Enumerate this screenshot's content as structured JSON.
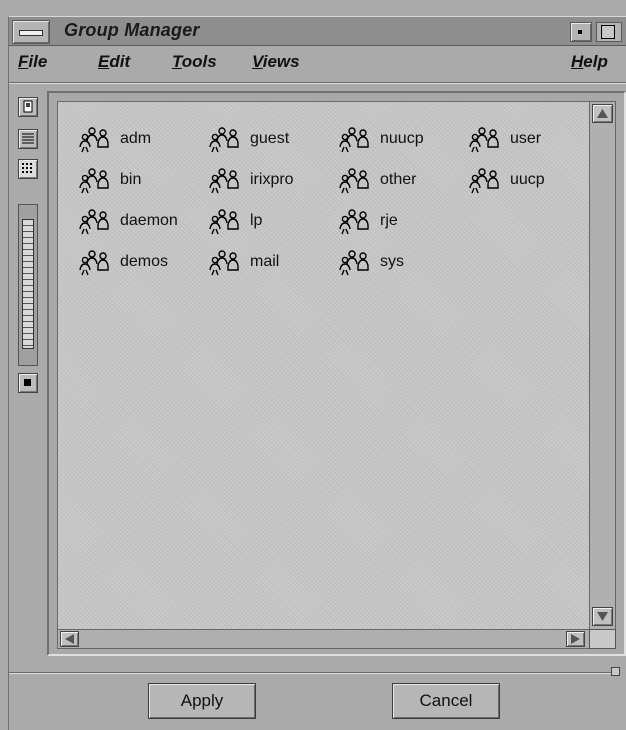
{
  "window": {
    "title": "Group Manager"
  },
  "menubar": {
    "items": [
      {
        "label": "File",
        "mnemonic": "F",
        "rest": "ile"
      },
      {
        "label": "Edit",
        "mnemonic": "E",
        "rest": "dit"
      },
      {
        "label": "Tools",
        "mnemonic": "T",
        "rest": "ools"
      },
      {
        "label": "Views",
        "mnemonic": "V",
        "rest": "iews"
      },
      {
        "label": "Help",
        "mnemonic": "H",
        "rest": "elp"
      }
    ]
  },
  "toolbar": {
    "icons": [
      "view-shelf-icon",
      "list-view-icon",
      "grid-view-icon",
      "zoom-slider",
      "zoom-reset-icon"
    ]
  },
  "groups": {
    "icon": "group-people-icon",
    "items": [
      "adm",
      "guest",
      "nuucp",
      "user",
      "bin",
      "irixpro",
      "other",
      "uucp",
      "daemon",
      "lp",
      "rje",
      "demos",
      "mail",
      "sys"
    ]
  },
  "buttons": {
    "apply": "Apply",
    "cancel": "Cancel"
  },
  "colors": {
    "background": "#aaaaaa",
    "titlebar": "#8e8e8e",
    "view": "#c6c6c6"
  }
}
